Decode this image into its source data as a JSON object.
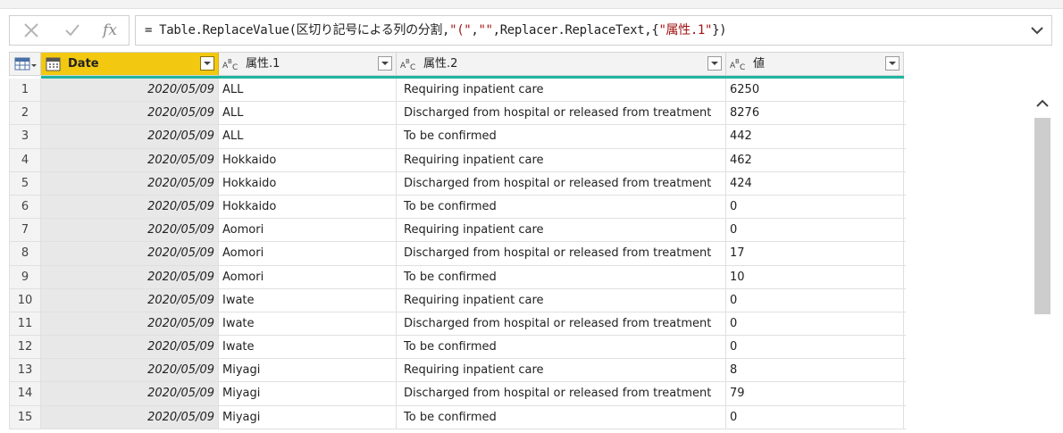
{
  "formula": {
    "prefix": "= Table.ReplaceValue(区切り記号による列の分割,",
    "s1": "\"(\"",
    "comma1": ",",
    "s2": "\"\"",
    "middle": ",Replacer.ReplaceText,{",
    "s3": "\"属性.1\"",
    "suffix": "})"
  },
  "columns": {
    "date": "Date",
    "attr1": "属性.1",
    "attr2": "属性.2",
    "value": "値"
  },
  "rows": [
    {
      "idx": "1",
      "date": "2020/05/09",
      "a1": "ALL",
      "a2": "Requiring inpatient care",
      "v": "6250"
    },
    {
      "idx": "2",
      "date": "2020/05/09",
      "a1": "ALL",
      "a2": "Discharged from hospital or released from treatment",
      "v": "8276"
    },
    {
      "idx": "3",
      "date": "2020/05/09",
      "a1": "ALL",
      "a2": "To be confirmed",
      "v": "442"
    },
    {
      "idx": "4",
      "date": "2020/05/09",
      "a1": "Hokkaido",
      "a2": "Requiring inpatient care",
      "v": "462"
    },
    {
      "idx": "5",
      "date": "2020/05/09",
      "a1": "Hokkaido",
      "a2": "Discharged from hospital or released from treatment",
      "v": "424"
    },
    {
      "idx": "6",
      "date": "2020/05/09",
      "a1": "Hokkaido",
      "a2": "To be confirmed",
      "v": "0"
    },
    {
      "idx": "7",
      "date": "2020/05/09",
      "a1": "Aomori",
      "a2": "Requiring inpatient care",
      "v": "0"
    },
    {
      "idx": "8",
      "date": "2020/05/09",
      "a1": "Aomori",
      "a2": "Discharged from hospital or released from treatment",
      "v": "17"
    },
    {
      "idx": "9",
      "date": "2020/05/09",
      "a1": "Aomori",
      "a2": "To be confirmed",
      "v": "10"
    },
    {
      "idx": "10",
      "date": "2020/05/09",
      "a1": "Iwate",
      "a2": "Requiring inpatient care",
      "v": "0"
    },
    {
      "idx": "11",
      "date": "2020/05/09",
      "a1": "Iwate",
      "a2": "Discharged from hospital or released from treatment",
      "v": "0"
    },
    {
      "idx": "12",
      "date": "2020/05/09",
      "a1": "Iwate",
      "a2": "To be confirmed",
      "v": "0"
    },
    {
      "idx": "13",
      "date": "2020/05/09",
      "a1": "Miyagi",
      "a2": "Requiring inpatient care",
      "v": "8"
    },
    {
      "idx": "14",
      "date": "2020/05/09",
      "a1": "Miyagi",
      "a2": "Discharged from hospital or released from treatment",
      "v": "79"
    },
    {
      "idx": "15",
      "date": "2020/05/09",
      "a1": "Miyagi",
      "a2": "To be confirmed",
      "v": "0"
    }
  ],
  "colors": {
    "accent_header": "#f2c811",
    "quality_bar": "#1fb5a0"
  },
  "icons": [
    "cancel-icon",
    "check-icon",
    "fx-icon",
    "chevron-down-icon",
    "table-icon",
    "calendar-icon",
    "abc-type-icon",
    "chevron-up-icon"
  ]
}
